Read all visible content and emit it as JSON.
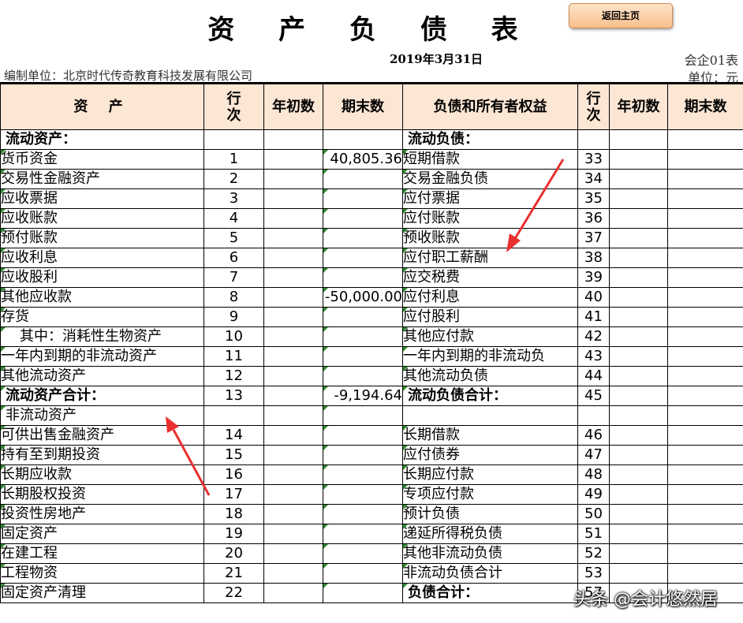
{
  "title": "资 产 负 债 表",
  "home_button": "返回主页",
  "date": "2019年3月31日",
  "form_no": "会企01表",
  "company": "编制单位：北京时代传奇教育科技发展有限公司",
  "unit": "单位：元",
  "headers": {
    "asset": "资  产",
    "line_no": "行次",
    "line_no_top": "行",
    "line_no_bottom": "次",
    "opening": "年初数",
    "closing": "期末数",
    "liability": "负债和所有者权益"
  },
  "rows": [
    {
      "a_name": "流动资产：",
      "a_line": "",
      "a_close": "",
      "l_name": "流动负债：",
      "l_line": ""
    },
    {
      "a_name": "货币资金",
      "a_line": "1",
      "a_close": "40,805.36",
      "l_name": "短期借款",
      "l_line": "33"
    },
    {
      "a_name": "交易性金融资产",
      "a_line": "2",
      "a_close": "",
      "l_name": "交易金融负债",
      "l_line": "34"
    },
    {
      "a_name": "应收票据",
      "a_line": "3",
      "a_close": "",
      "l_name": "应付票据",
      "l_line": "35"
    },
    {
      "a_name": "应收账款",
      "a_line": "4",
      "a_close": "",
      "l_name": "应付账款",
      "l_line": "36"
    },
    {
      "a_name": "预付账款",
      "a_line": "5",
      "a_close": "",
      "l_name": "预收账款",
      "l_line": "37"
    },
    {
      "a_name": "应收利息",
      "a_line": "6",
      "a_close": "",
      "l_name": "应付职工薪酬",
      "l_line": "38"
    },
    {
      "a_name": "应收股利",
      "a_line": "7",
      "a_close": "",
      "l_name": "应交税费",
      "l_line": "39"
    },
    {
      "a_name": "其他应收款",
      "a_line": "8",
      "a_close": "-50,000.00",
      "l_name": "应付利息",
      "l_line": "40"
    },
    {
      "a_name": "存货",
      "a_line": "9",
      "a_close": "",
      "l_name": "应付股利",
      "l_line": "41"
    },
    {
      "a_name": "其中：消耗性生物资产",
      "a_line": "10",
      "a_close": "",
      "l_name": "其他应付款",
      "l_line": "42"
    },
    {
      "a_name": "一年内到期的非流动资产",
      "a_line": "11",
      "a_close": "",
      "l_name": "一年内到期的非流动负",
      "l_line": "43"
    },
    {
      "a_name": "其他流动资产",
      "a_line": "12",
      "a_close": "",
      "l_name": "其他流动负债",
      "l_line": "44"
    },
    {
      "a_name": "流动资产合计：",
      "a_line": "13",
      "a_close": "-9,194.64",
      "l_name": "流动负债合计：",
      "l_line": "45"
    },
    {
      "a_name": "非流动资产",
      "a_line": "",
      "a_close": "",
      "l_name": "",
      "l_line": ""
    },
    {
      "a_name": "可供出售金融资产",
      "a_line": "14",
      "a_close": "",
      "l_name": "长期借款",
      "l_line": "46"
    },
    {
      "a_name": "持有至到期投资",
      "a_line": "15",
      "a_close": "",
      "l_name": "应付债券",
      "l_line": "47"
    },
    {
      "a_name": "长期应收款",
      "a_line": "16",
      "a_close": "",
      "l_name": "长期应付款",
      "l_line": "48"
    },
    {
      "a_name": "长期股权投资",
      "a_line": "17",
      "a_close": "",
      "l_name": "专项应付款",
      "l_line": "49"
    },
    {
      "a_name": "投资性房地产",
      "a_line": "18",
      "a_close": "",
      "l_name": "预计负债",
      "l_line": "50"
    },
    {
      "a_name": "固定资产",
      "a_line": "19",
      "a_close": "",
      "l_name": "递延所得税负债",
      "l_line": "51"
    },
    {
      "a_name": "在建工程",
      "a_line": "20",
      "a_close": "",
      "l_name": "其他非流动负债",
      "l_line": "52"
    },
    {
      "a_name": "工程物资",
      "a_line": "21",
      "a_close": "",
      "l_name": "非流动负债合计",
      "l_line": "53"
    },
    {
      "a_name": "固定资产清理",
      "a_line": "22",
      "a_close": "",
      "l_name": "负债合计：",
      "l_line": "57"
    }
  ],
  "watermark": "头条 @会计悠然居",
  "colors": {
    "header_bg": "#fce6d4",
    "button_bg": "#f8c08e",
    "arrow": "#e8312f",
    "cell_marker": "#2e8b2e"
  }
}
